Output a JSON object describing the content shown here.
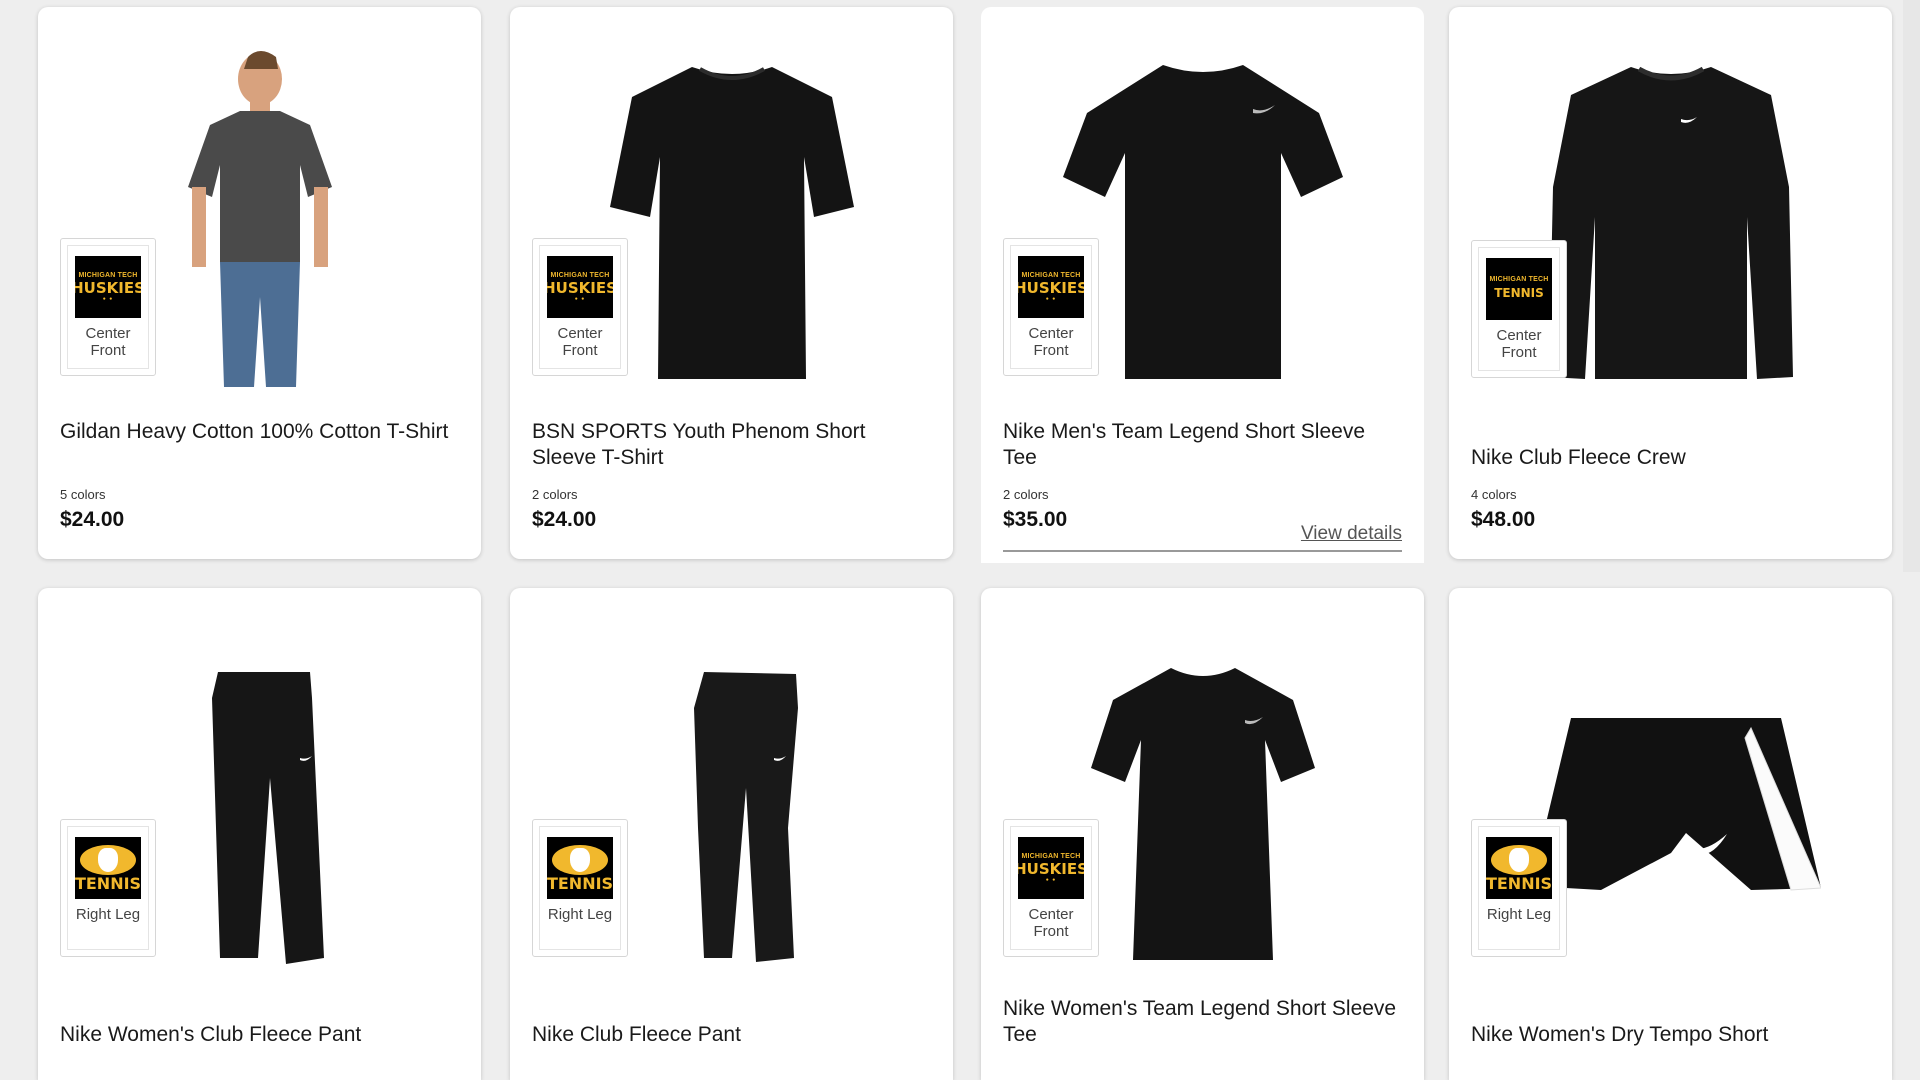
{
  "products": [
    {
      "name": "Gildan Heavy Cotton 100% Cotton T-Shirt",
      "colors": "5 colors",
      "price": "$24.00",
      "decoration": {
        "logo": "MICHIGAN TECH HUSKIES",
        "location": "Center Front"
      },
      "image": "gray-tshirt-model"
    },
    {
      "name": "BSN SPORTS Youth Phenom Short Sleeve T-Shirt",
      "colors": "2 colors",
      "price": "$24.00",
      "decoration": {
        "logo": "MICHIGAN TECH HUSKIES",
        "location": "Center Front"
      },
      "image": "black-tshirt"
    },
    {
      "name": "Nike Men's Team Legend Short Sleeve Tee",
      "colors": "2 colors",
      "price": "$35.00",
      "view_details": "View details",
      "decoration": {
        "logo": "MICHIGAN TECH HUSKIES",
        "location": "Center Front"
      },
      "image": "black-nike-tee"
    },
    {
      "name": "Nike Club Fleece Crew",
      "colors": "4 colors",
      "price": "$48.00",
      "decoration": {
        "logo": "MICHIGAN TECH TENNIS",
        "location": "Center Front"
      },
      "image": "black-crewneck"
    },
    {
      "name": "Nike Women's Club Fleece Pant",
      "decoration": {
        "logo": "TENNIS",
        "location": "Right Leg"
      },
      "image": "black-pants"
    },
    {
      "name": "Nike Club Fleece Pant",
      "decoration": {
        "logo": "TENNIS",
        "location": "Right Leg"
      },
      "image": "black-joggers"
    },
    {
      "name": "Nike Women's Team Legend Short Sleeve Tee",
      "decoration": {
        "logo": "MICHIGAN TECH HUSKIES",
        "location": "Center Front"
      },
      "image": "black-womens-tee"
    },
    {
      "name": "Nike Women's Dry Tempo Short",
      "decoration": {
        "logo": "TENNIS",
        "location": "Right Leg"
      },
      "image": "black-shorts"
    }
  ],
  "logo_text": {
    "mt": "MICHIGAN TECH",
    "huskies": "HUSKIES",
    "tennis": "TENNIS",
    "tennis_small": "TENNIS"
  },
  "colors": {
    "logo_gold": "#f1b82d",
    "logo_black": "#000000",
    "garment": "#141414"
  }
}
